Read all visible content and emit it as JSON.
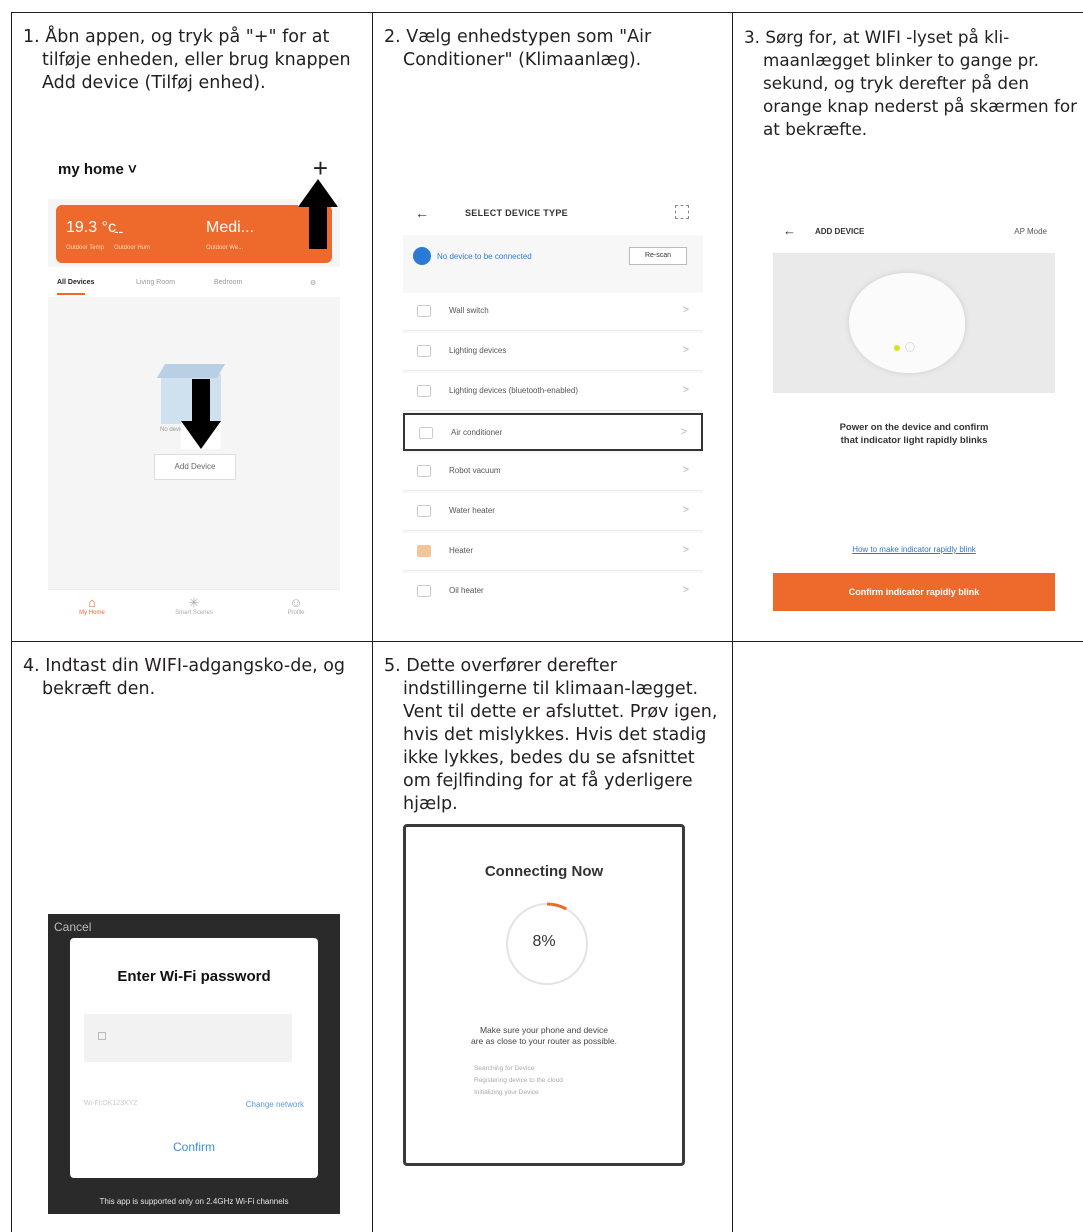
{
  "steps": [
    {
      "text": "1. Åbn appen, og tryk på \"+\" for at tilføje enheden, eller brug knappen Add device (Tilføj enhed)."
    },
    {
      "text": "2. Vælg enhedstypen som \"Air Conditioner\" (Klimaanlæg)."
    },
    {
      "text": "3. Sørg for, at WIFI -lyset på kli-maanlægget blinker to gange pr. sekund, og tryk derefter på den orange knap nederst på skærmen for at bekræfte."
    },
    {
      "text": "4. Indtast din WIFI-adgangsko-de, og bekræft den."
    },
    {
      "text": "5. Dette overfører derefter indstillingerne til klimaan-lægget. Vent til dette er afsluttet. Prøv igen, hvis det mislykkes. Hvis det stadig ikke lykkes, bedes du se afsnittet om fejlfinding for at få yderligere hjælp."
    }
  ],
  "screen1": {
    "home_title": "my home ˅",
    "plus": "+",
    "temp": "19.3 °c",
    "dash": "--",
    "medi": "Medi...",
    "temp_sub": "Outdoor Temp",
    "humidity_sub": "Outdoor Hum",
    "weather_sub": "Outdoor We...",
    "tabs": [
      "All Devices",
      "Living Room",
      "Bedroom"
    ],
    "no_devices": "No devices",
    "add_device": "Add Device",
    "nav": [
      "My Home",
      "Smart Scenes",
      "Profile"
    ]
  },
  "screen2": {
    "back": "←",
    "title": "SELECT DEVICE TYPE",
    "bt_message": "No device to be connected",
    "rescan": "Re-scan",
    "items": [
      "Wall switch",
      "Lighting devices",
      "Lighting devices (bluetooth-enabled)",
      "Air conditioner",
      "Robot vacuum",
      "Water heater",
      "Heater",
      "Oil heater"
    ]
  },
  "screen3": {
    "back": "←",
    "title": "ADD DEVICE",
    "mode": "AP Mode",
    "message_line1": "Power on the device and confirm",
    "message_line2": "that indicator light rapidly blinks",
    "link": "How to make indicator rapidly blink",
    "confirm": "Confirm indicator rapidly blink"
  },
  "screen4": {
    "cancel": "Cancel",
    "title": "Enter Wi-Fi password",
    "ssid": "Wi-Fi:OK123XYZ",
    "change_network": "Change network",
    "confirm": "Confirm",
    "footer": "This app is supported only on 2.4GHz Wi-Fi channels"
  },
  "screen5": {
    "title": "Connecting Now",
    "percent": "8%",
    "progress": 0.08,
    "message_line1": "Make sure your phone and device",
    "message_line2": "are as close to your router as possible.",
    "status": [
      "Searching for Device",
      "Registering device to the cloud",
      "Initializing your Device"
    ]
  },
  "colors": {
    "accent": "#ee6a2c",
    "link": "#2f76c8",
    "grid": "#231f20"
  }
}
